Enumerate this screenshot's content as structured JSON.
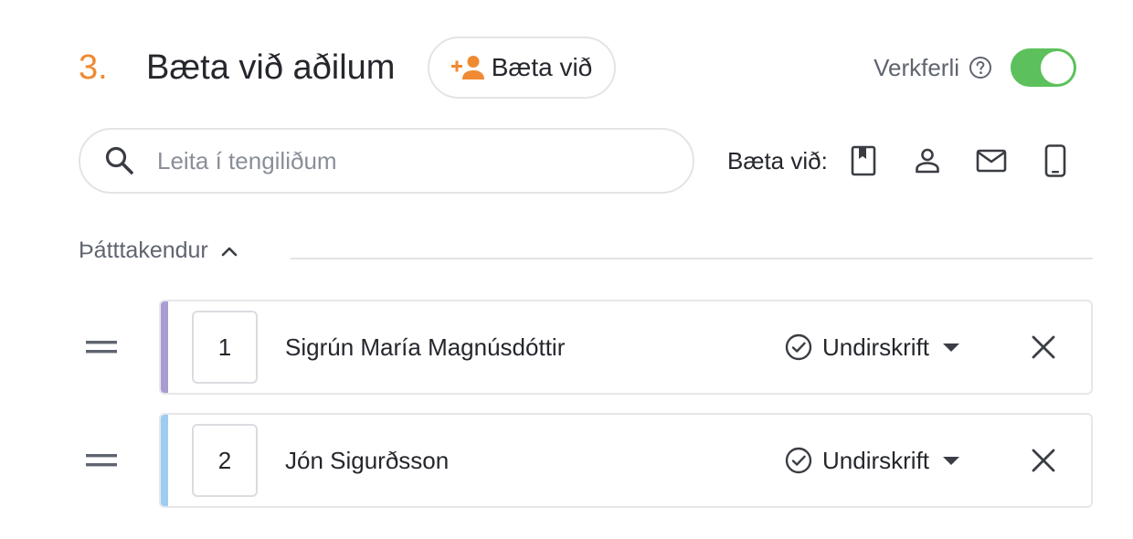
{
  "header": {
    "step_number": "3.",
    "title": "Bæta við aðilum",
    "add_button_label": "Bæta við",
    "workflow_label": "Verkferli",
    "workflow_enabled": true
  },
  "search": {
    "placeholder": "Leita í tengiliðum",
    "value": ""
  },
  "add_via": {
    "label": "Bæta við:",
    "icons": [
      "contacts-book-icon",
      "person-icon",
      "email-icon",
      "mobile-phone-icon"
    ]
  },
  "participants": {
    "section_label": "Þátttakendur",
    "expanded": true,
    "items": [
      {
        "order": "1",
        "name": "Sigrún María Magnúsdóttir",
        "role": "Undirskrift",
        "color": "#ab9bd3"
      },
      {
        "order": "2",
        "name": "Jón Sigurðsson",
        "role": "Undirskrift",
        "color": "#9ecbf1"
      }
    ]
  },
  "colors": {
    "accent": "#ef8a32",
    "toggle_on": "#5cc15c",
    "icon": "#5f6470"
  }
}
